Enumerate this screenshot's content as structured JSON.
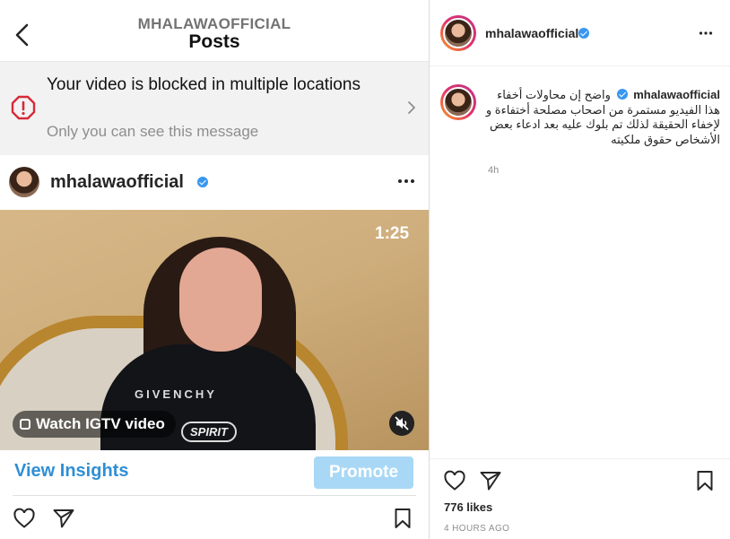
{
  "header": {
    "username": "MHALAWAOFFICIAL",
    "title": "Posts"
  },
  "blocked_banner": {
    "title": "Your video is blocked in multiple locations",
    "subtitle": "Only you can see this message"
  },
  "post": {
    "username": "mhalawaofficial",
    "verified": true,
    "more_icon": "more-horizontal-icon",
    "video": {
      "duration": "1:25",
      "shirt_text": "GIVENCHY",
      "shirt_badge": "SPIRIT",
      "watch_label": "Watch IGTV video",
      "muted": true
    },
    "insights_label": "View Insights",
    "promote_label": "Promote"
  },
  "right_panel": {
    "username": "mhalawaofficial",
    "caption_username": "mhalawaofficial",
    "caption": "واضح إن محاولات أخفاء هذا الفيديو مستمرة من اصحاب مصلحة أختفاءة و لإخفاء الحقيقة لذلك تم بلوك عليه بعد ادعاء بعض الأشخاص حقوق ملكيته",
    "caption_time": "4h",
    "likes": "776 likes",
    "posted_ago": "4 HOURS AGO"
  },
  "colors": {
    "accent_link": "#2f8fd6",
    "promote_bg": "#a8d8f5",
    "warning_red": "#d62a3a",
    "verified_blue": "#3897f0"
  }
}
